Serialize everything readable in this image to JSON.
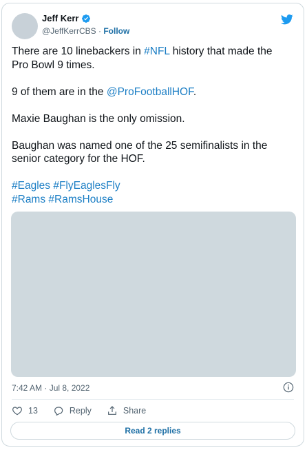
{
  "author": {
    "name": "Jeff Kerr",
    "handle": "@JeffKerrCBS",
    "separator": "·",
    "follow_label": "Follow"
  },
  "tweet": {
    "p1_a": "There are 10 linebackers in ",
    "p1_tag": "#NFL",
    "p1_b": " history that made the Pro Bowl 9 times.",
    "p2_a": "9 of them are in the ",
    "p2_mention": "@ProFootballHOF",
    "p2_b": ".",
    "p3": "Maxie Baughan is the only omission.",
    "p4": "Baughan was named one of the 25 semifinalists in the senior category for the HOF.",
    "hashtags_line1": [
      "#Eagles",
      "#FlyEaglesFly"
    ],
    "hashtags_line2": [
      "#Rams",
      "#RamsHouse"
    ]
  },
  "meta": {
    "timestamp": "7:42 AM · Jul 8, 2022"
  },
  "actions": {
    "like_count": "13",
    "reply_label": "Reply",
    "share_label": "Share"
  },
  "footer": {
    "read_replies_label": "Read 2 replies"
  },
  "colors": {
    "link": "#1d7fc5",
    "verified": "#1d9bf0",
    "twitter_brand": "#1d9bf0",
    "media_placeholder": "#cfd9de"
  },
  "icons": [
    "verified-badge-icon",
    "twitter-bird-icon",
    "info-icon",
    "heart-icon",
    "reply-icon",
    "share-icon"
  ]
}
